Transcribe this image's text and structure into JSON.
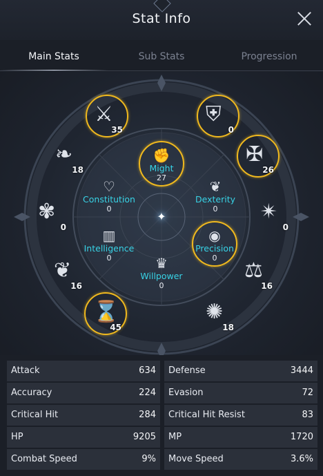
{
  "header": {
    "title": "Stat Info"
  },
  "tabs": [
    {
      "label": "Main Stats"
    },
    {
      "label": "Sub Stats"
    },
    {
      "label": "Progression"
    }
  ],
  "colors": {
    "gold_ring": "#f0b91e",
    "attr_name": "#38d3e6",
    "cell_bg": "#2b303a"
  },
  "nodes": [
    {
      "icon": "sword-crest-icon",
      "value": "35"
    },
    {
      "icon": "shield-crest-icon",
      "value": "0"
    },
    {
      "icon": "crossed-swords-icon",
      "value": "26"
    },
    {
      "icon": "star-crest-icon",
      "value": "0"
    },
    {
      "icon": "scales-icon",
      "value": "16"
    },
    {
      "icon": "swirl-icon",
      "value": "18"
    },
    {
      "icon": "hourglass-crest-icon",
      "value": "45"
    },
    {
      "icon": "tree-crest-icon",
      "value": "16"
    },
    {
      "icon": "butterfly-icon",
      "value": "0"
    },
    {
      "icon": "feather-swirl-icon",
      "value": "18"
    }
  ],
  "attributes": [
    {
      "name": "Might",
      "value": "27",
      "icon": "fist-icon"
    },
    {
      "name": "Constitution",
      "value": "0",
      "icon": "heart-icon"
    },
    {
      "name": "Dexterity",
      "value": "0",
      "icon": "wing-icon"
    },
    {
      "name": "Intelligence",
      "value": "0",
      "icon": "book-icon"
    },
    {
      "name": "Precision",
      "value": "0",
      "icon": "eye-icon"
    },
    {
      "name": "Willpower",
      "value": "0",
      "icon": "crown-icon"
    }
  ],
  "stats": [
    {
      "left": {
        "label": "Attack",
        "value": "634"
      },
      "right": {
        "label": "Defense",
        "value": "3444"
      }
    },
    {
      "left": {
        "label": "Accuracy",
        "value": "224"
      },
      "right": {
        "label": "Evasion",
        "value": "72"
      }
    },
    {
      "left": {
        "label": "Critical Hit",
        "value": "284"
      },
      "right": {
        "label": "Critical Hit Resist",
        "value": "83"
      }
    },
    {
      "left": {
        "label": "HP",
        "value": "9205"
      },
      "right": {
        "label": "MP",
        "value": "1720"
      }
    },
    {
      "left": {
        "label": "Combat Speed",
        "value": "9%"
      },
      "right": {
        "label": "Move Speed",
        "value": "3.6%"
      }
    }
  ]
}
